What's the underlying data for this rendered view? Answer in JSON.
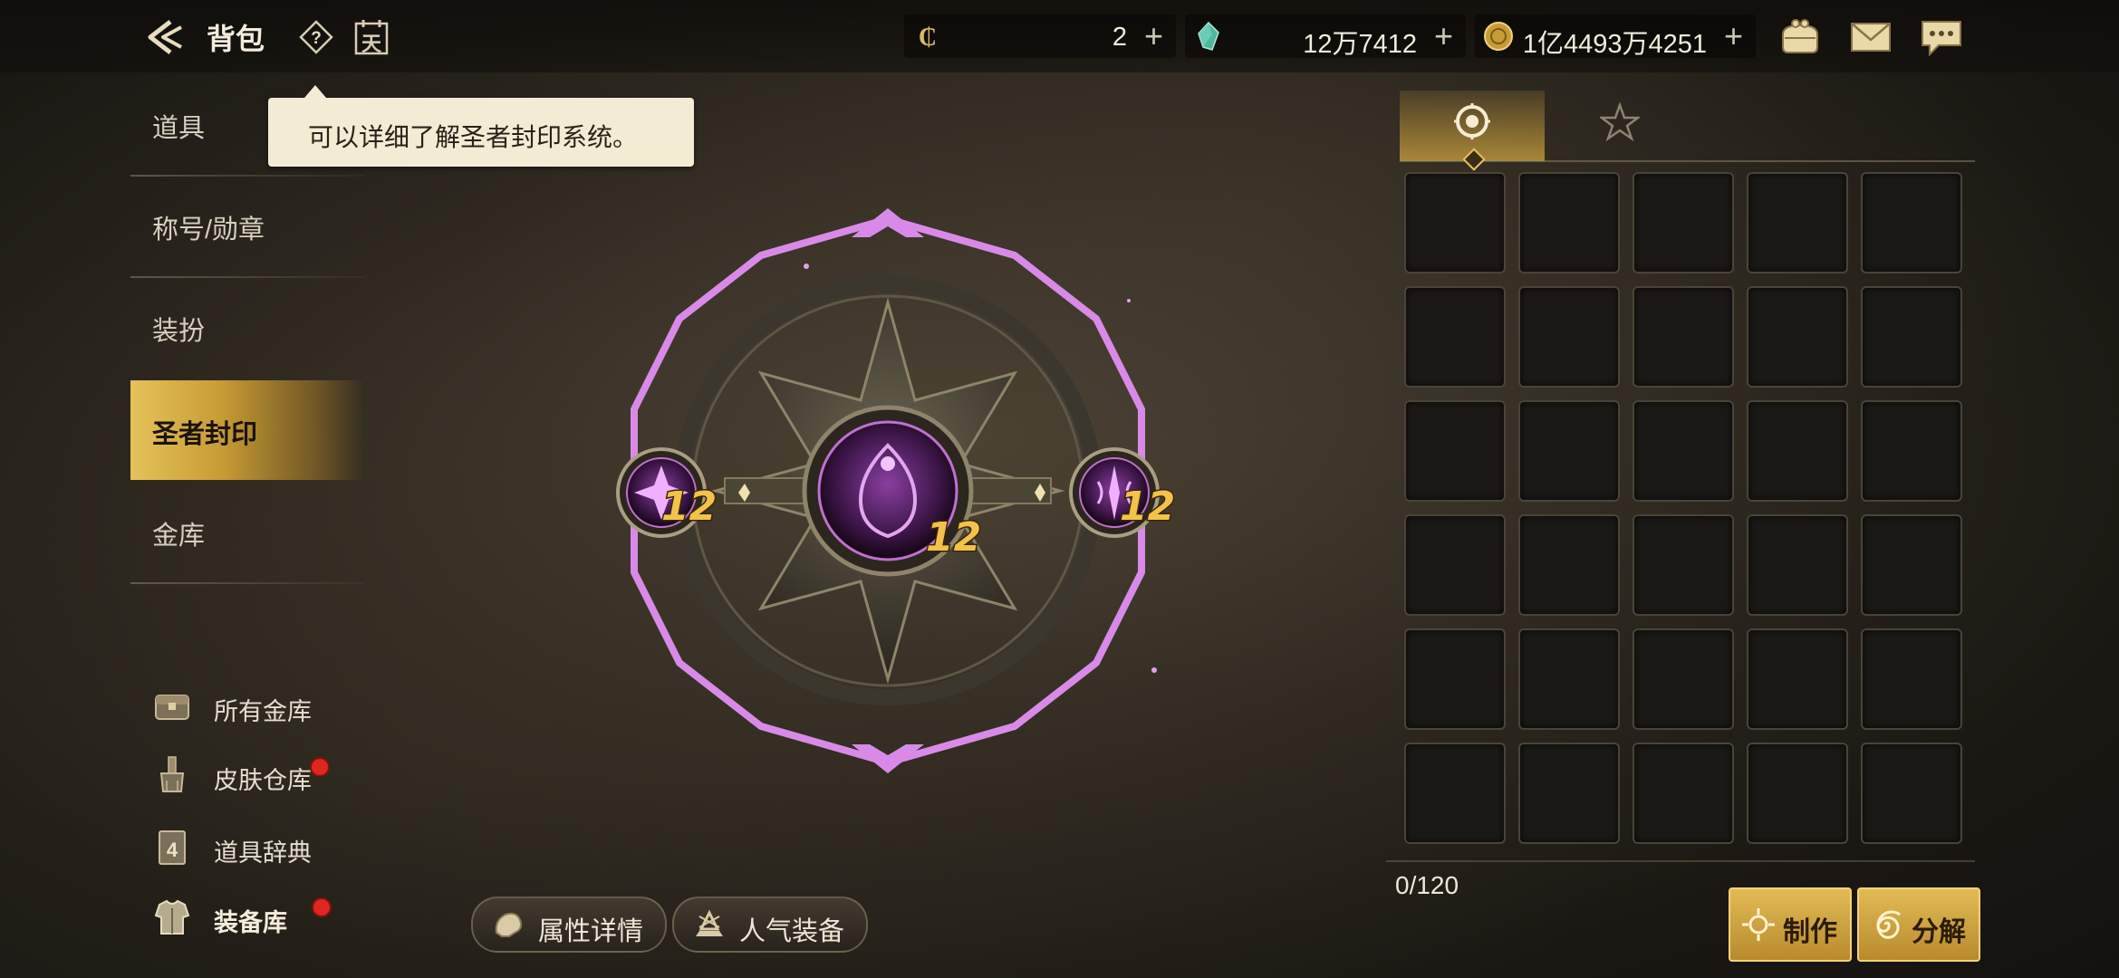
{
  "header": {
    "title": "背包",
    "currencies": [
      {
        "icon": "coin-c-icon",
        "value": "2"
      },
      {
        "icon": "crystal-icon",
        "value": "12万7412"
      },
      {
        "icon": "gold-coin-icon",
        "value": "1亿4493万4251"
      }
    ],
    "calendar_glyph": "天"
  },
  "tooltip": {
    "text": "可以详细了解圣者封印系统。"
  },
  "sidebar": {
    "items": [
      {
        "label": "道具"
      },
      {
        "label": "称号/勋章"
      },
      {
        "label": "装扮"
      },
      {
        "label": "圣者封印",
        "active": true
      },
      {
        "label": "金库"
      }
    ],
    "sub_items": [
      {
        "label": "所有金库",
        "icon": "treasure-chest-icon"
      },
      {
        "label": "皮肤仓库",
        "icon": "brush-icon",
        "badge": true
      },
      {
        "label": "道具辞典",
        "icon": "dictionary-icon"
      },
      {
        "label": "装备库",
        "icon": "armor-icon",
        "badge": true
      }
    ]
  },
  "seal": {
    "center_level": "12",
    "left_level": "12",
    "right_level": "12"
  },
  "bottom_buttons": {
    "attributes_label": "属性详情",
    "popular_label": "人气装备"
  },
  "inventory": {
    "tabs": [
      {
        "icon": "seal-ring-icon",
        "active": true
      },
      {
        "icon": "pentagram-icon",
        "active": false
      }
    ],
    "count": "0/120",
    "craft_label": "制作",
    "decompose_label": "分解"
  },
  "colors": {
    "accent_gold": "#d9b04a",
    "seal_purple": "#d98ae8",
    "badge_red": "#e0271f"
  }
}
